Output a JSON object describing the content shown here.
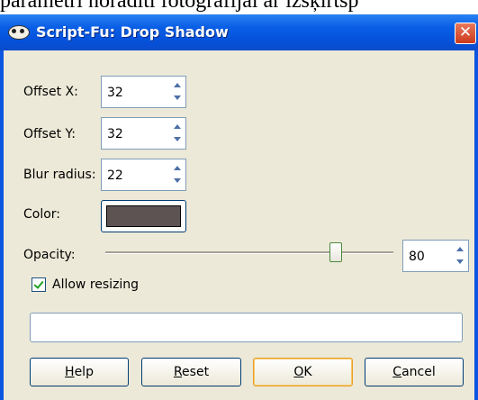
{
  "background_text": "parametri noradīti fotogrāfijai ar izšķirtsp",
  "window": {
    "title": "Script-Fu: Drop Shadow",
    "close_glyph": "✕",
    "app_icon": "gimp-wilber-icon"
  },
  "fields": {
    "offset_x": {
      "label": "Offset X:",
      "value": "32"
    },
    "offset_y": {
      "label": "Offset Y:",
      "value": "32"
    },
    "blur_radius": {
      "label": "Blur radius:",
      "value": "22"
    },
    "color": {
      "label": "Color:",
      "swatch": "#5d5353"
    },
    "opacity": {
      "label": "Opacity:",
      "value": "80",
      "slider_fraction": 0.8
    }
  },
  "allow_resizing": {
    "label": "Allow resizing",
    "checked": true
  },
  "progress": {
    "text": ""
  },
  "buttons": {
    "help": {
      "mnemonic": "H",
      "rest": "elp"
    },
    "reset": {
      "mnemonic": "R",
      "rest": "eset"
    },
    "ok": {
      "mnemonic": "O",
      "rest": "K"
    },
    "cancel": {
      "mnemonic": "C",
      "rest": "ancel"
    }
  },
  "colors": {
    "titlebar": "#0a5fe6",
    "dialog_bg": "#ece9d8",
    "field_border": "#7f9db9",
    "default_button_highlight": "#e8a02a"
  }
}
